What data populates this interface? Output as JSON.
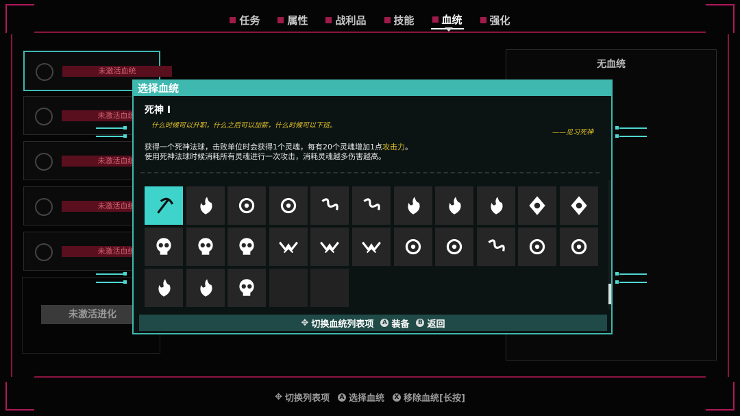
{
  "tabs": [
    {
      "label": "任务"
    },
    {
      "label": "属性"
    },
    {
      "label": "战利品"
    },
    {
      "label": "技能"
    },
    {
      "label": "血统"
    },
    {
      "label": "强化"
    }
  ],
  "left_slots": [
    {
      "label": "未激活血统"
    },
    {
      "label": "未激活血统"
    },
    {
      "label": "未激活血统"
    },
    {
      "label": "未激活血统"
    },
    {
      "label": "未激活血统"
    }
  ],
  "evolve_label": "未激活进化",
  "right_panel": {
    "title": "无血统"
  },
  "dialog": {
    "title": "选择血统",
    "name": "死神 I",
    "quote": "什么时候可以升职，什么之后可以加薪，什么时候可以下班。",
    "signature": "——见习死神",
    "desc_line1_pre": "获得一个死神法球，击败单位时会获得1个灵魂，每有20个灵魂增加1点",
    "desc_line1_hl": "攻击力",
    "desc_line1_post": "。",
    "desc_line2": "使用死神法球时候消耗所有灵魂进行一次攻击，消耗灵魂越多伤害越高。",
    "footer": {
      "switch": "切换血统列表项",
      "equip": "装备",
      "back": "返回",
      "equip_key": "A",
      "back_key": "B"
    }
  },
  "icons": [
    "scythe-icon",
    "trident-flame-icon",
    "horned-demon-icon",
    "tree-spirit-icon",
    "serpent-icon",
    "serpent-2-icon",
    "flame-icon",
    "flame-2-icon",
    "flame-3-icon",
    "crystal-eye-icon",
    "crystal-eye-2-icon",
    "skull-icon",
    "skull-2-icon",
    "skull-3-icon",
    "bat-wing-icon",
    "bat-wing-2-icon",
    "bat-wing-3-icon",
    "z-rune-icon",
    "eye-star-icon",
    "vortex-icon",
    "fox-icon",
    "eye-sun-icon",
    "lotus-icon",
    "lotus-2-icon",
    "hooded-skull-icon",
    "empty",
    "empty"
  ],
  "bottom_bar": {
    "switch": "切换列表项",
    "select": "选择血统",
    "remove": "移除血统[长按]",
    "select_key": "A",
    "remove_key": "X"
  },
  "colors": {
    "accent": "#3fb9b0",
    "frame": "#b0175a",
    "highlight": "#e1c02a"
  }
}
